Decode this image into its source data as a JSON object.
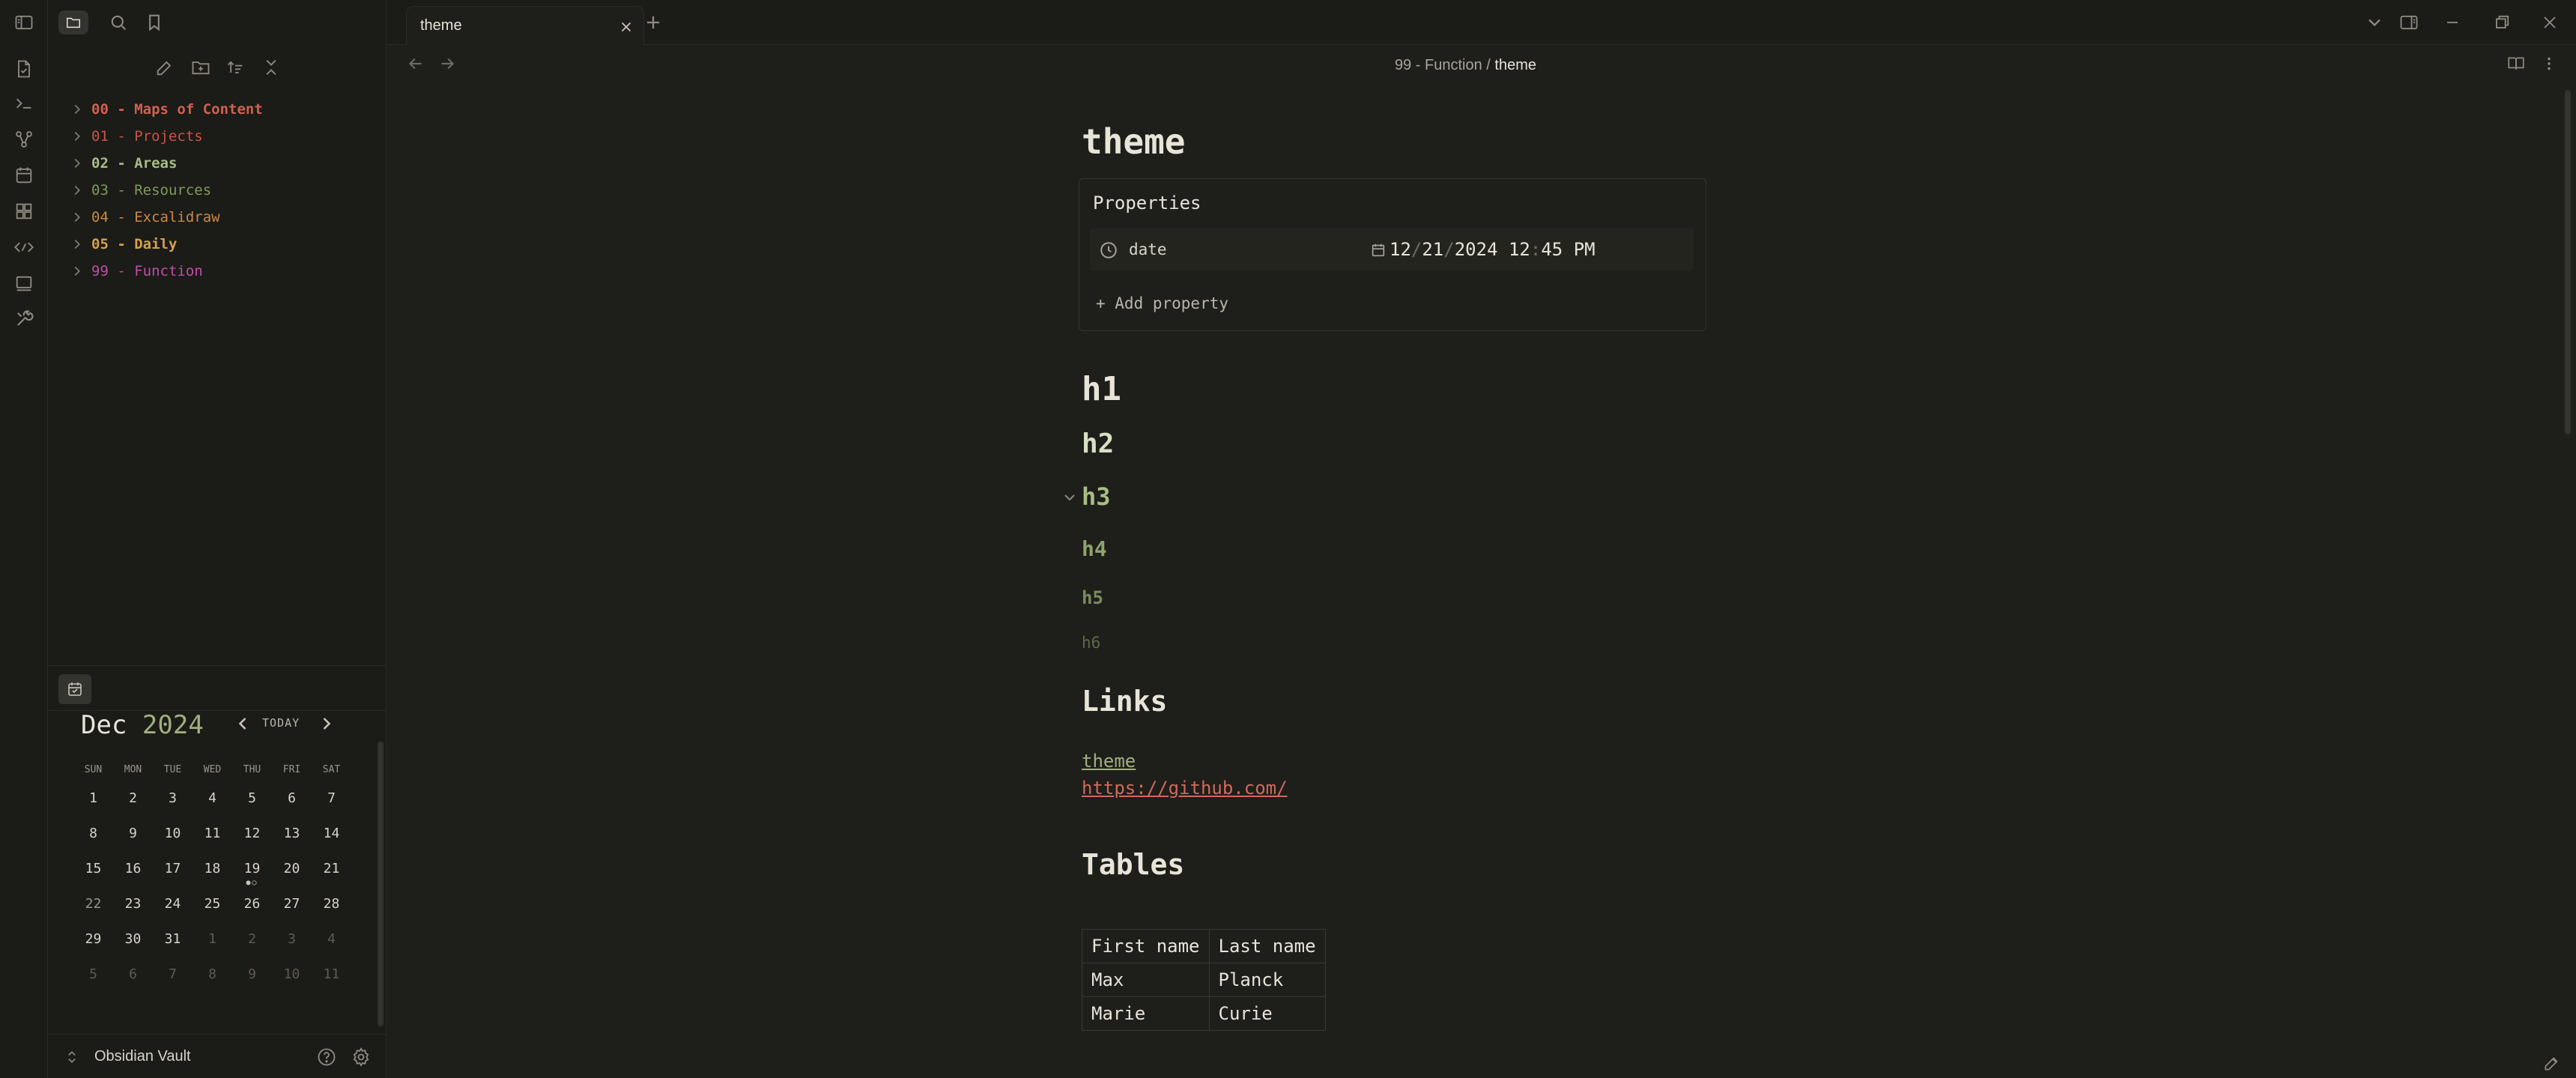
{
  "ribbon": {
    "icons": [
      "file-icon",
      "terminal-icon",
      "graph-icon",
      "calendar-icon",
      "blocks-icon",
      "code-percent-icon",
      "slides-icon",
      "tools-icon"
    ]
  },
  "sidebar": {
    "tabs": [
      "files-icon",
      "search-icon",
      "bookmark-icon"
    ],
    "actions": [
      "new-note-icon",
      "new-folder-icon",
      "sort-icon",
      "collapse-all-icon"
    ],
    "tree": [
      {
        "label": "00 - Maps of Content",
        "color": "#d0614f"
      },
      {
        "label": "01 - Projects",
        "color": "#c95448"
      },
      {
        "label": "02 - Areas",
        "color": "#a8bd84"
      },
      {
        "label": "03 - Resources",
        "color": "#7d9c5c"
      },
      {
        "label": "04 - Excalidraw",
        "color": "#c98a45"
      },
      {
        "label": "05 - Daily",
        "color": "#d7a04b"
      },
      {
        "label": "99 - Function",
        "color": "#c04ea8"
      }
    ]
  },
  "calendar": {
    "month": "Dec",
    "year": "2024",
    "today_label": "TODAY",
    "weekdays": [
      "SUN",
      "MON",
      "TUE",
      "WED",
      "THU",
      "FRI",
      "SAT"
    ],
    "weeks": [
      [
        "1",
        "2",
        "3",
        "4",
        "5",
        "6",
        "7"
      ],
      [
        "8",
        "9",
        "10",
        "11",
        "12",
        "13",
        "14"
      ],
      [
        "15",
        "16",
        "17",
        "18",
        "19",
        "20",
        "21"
      ],
      [
        "22",
        "23",
        "24",
        "25",
        "26",
        "27",
        "28"
      ],
      [
        "29",
        "30",
        "31",
        "1",
        "2",
        "3",
        "4"
      ],
      [
        "5",
        "6",
        "7",
        "8",
        "9",
        "10",
        "11"
      ]
    ],
    "dots_on": "19",
    "dots": "●○"
  },
  "vault": {
    "name": "Obsidian Vault"
  },
  "tabbar": {
    "active_tab": "theme"
  },
  "breadcrumb": {
    "parent": "99 - Function",
    "sep": "/",
    "current": "theme"
  },
  "note": {
    "title": "theme",
    "properties": {
      "heading": "Properties",
      "key": "date",
      "value": {
        "month": "12",
        "day": "21",
        "year": "2024",
        "hour": "12",
        "minute": "45",
        "ampm": "PM"
      },
      "add": "+ Add property"
    },
    "headings": [
      "h1",
      "h2",
      "h3",
      "h4",
      "h5",
      "h6"
    ],
    "links_heading": "Links",
    "links": [
      "theme",
      "https://github.com/"
    ],
    "tables_heading": "Tables",
    "table": {
      "headers": [
        "First name",
        "Last name"
      ],
      "rows": [
        [
          "Max",
          "Planck"
        ],
        [
          "Marie",
          "Curie"
        ]
      ]
    }
  }
}
